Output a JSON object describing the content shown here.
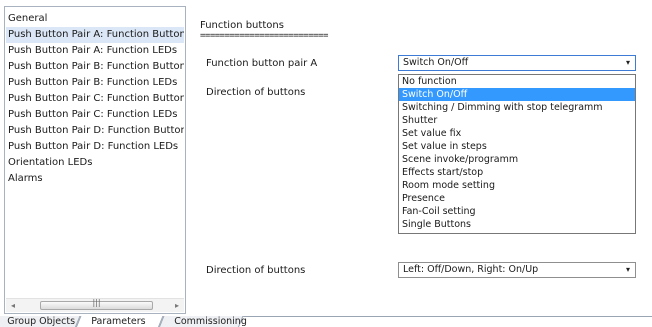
{
  "sidebar": {
    "items": [
      {
        "label": "General"
      },
      {
        "label": "Push Button Pair A: Function Buttons"
      },
      {
        "label": "Push Button Pair A: Function LEDs"
      },
      {
        "label": "Push Button Pair B: Function Buttons"
      },
      {
        "label": "Push Button Pair B: Function LEDs"
      },
      {
        "label": "Push Button Pair C: Function Buttons"
      },
      {
        "label": "Push Button Pair C: Function LEDs"
      },
      {
        "label": "Push Button Pair D: Function Buttons"
      },
      {
        "label": "Push Button Pair D: Function LEDs"
      },
      {
        "label": "Orientation LEDs"
      },
      {
        "label": "Alarms"
      }
    ],
    "selected_index": 1,
    "scroll": {
      "left_arrow": "◂",
      "right_arrow": "▸",
      "grip": "|||"
    }
  },
  "main": {
    "section_title": "Function buttons",
    "section_underline": "==========================",
    "params": [
      {
        "label": "Function button pair A",
        "value": "Switch On/Off"
      },
      {
        "label": "Direction of buttons",
        "value": ""
      },
      {
        "label": "Direction of buttons",
        "value": "Left: Off/Down, Right: On/Up"
      }
    ],
    "dropdown": {
      "options": [
        "No function",
        "Switch On/Off",
        "Switching / Dimming with stop telegramm",
        "Shutter",
        "Set value fix",
        "Set value in steps",
        "Scene invoke/programm",
        "Effects start/stop",
        "Room mode setting",
        "Presence",
        "Fan-Coil setting",
        "Single Buttons"
      ],
      "highlighted_index": 1,
      "caret": "▾"
    }
  },
  "tabs": [
    {
      "label": "Group Objects"
    },
    {
      "label": "Parameters"
    },
    {
      "label": "Commissioning"
    }
  ],
  "active_tab": "Parameters",
  "colors": {
    "selection": "#dbe7f6",
    "highlight": "#3399ff"
  }
}
